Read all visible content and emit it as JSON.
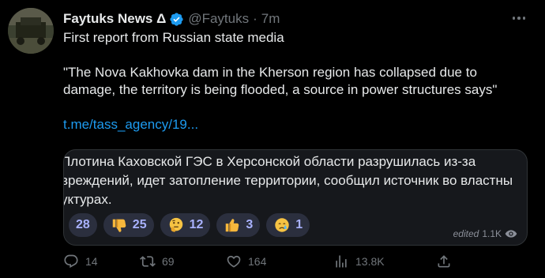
{
  "author": {
    "name": "Faytuks News Δ",
    "handle": "@Faytuks",
    "separator": "·",
    "time": "7m"
  },
  "tweet": {
    "line1": "First report from Russian state media",
    "quote": "\"The Nova Kakhovka dam in the Kherson region has collapsed due to damage, the territory is being flooded, a source in power structures says\"",
    "link": "t.me/tass_agency/19..."
  },
  "card": {
    "lines": [
      "Плотина Каховской ГЭС в Херсонской области разрушилась из-за",
      "вреждений, идет затопление территории, сообщил источник во властны",
      "уктурах."
    ],
    "reactions": [
      {
        "emoji": "",
        "count": "28"
      },
      {
        "emoji": "thumbs-down",
        "count": "25"
      },
      {
        "emoji": "thinking-face",
        "count": "12"
      },
      {
        "emoji": "thumbs-up",
        "count": "3"
      },
      {
        "emoji": "crying-face",
        "count": "1"
      }
    ],
    "edited_label": "edited",
    "views": "1.1K"
  },
  "actions": {
    "replies": "14",
    "retweets": "69",
    "likes": "164",
    "views": "13.8K"
  },
  "colors": {
    "background": "#000000",
    "text": "#e7e9ea",
    "muted": "#71767b",
    "link": "#1d9bf0",
    "verified": "#1d9bf0",
    "reaction_count": "#a9b2ff"
  }
}
